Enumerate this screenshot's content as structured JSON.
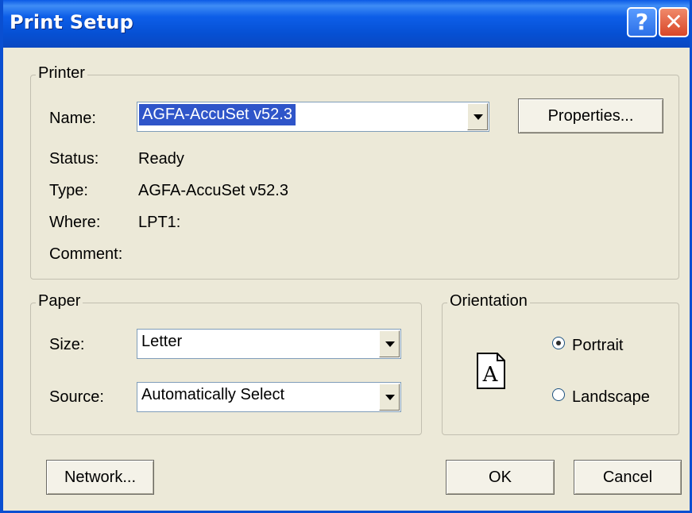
{
  "window": {
    "title": "Print Setup"
  },
  "titlebar": {
    "help_glyph": "?",
    "close_glyph": "✕"
  },
  "printer": {
    "group_label": "Printer",
    "name_label": "Name:",
    "name_value": "AGFA-AccuSet v52.3",
    "properties_button": "Properties...",
    "status_label": "Status:",
    "status_value": "Ready",
    "type_label": "Type:",
    "type_value": "AGFA-AccuSet v52.3",
    "where_label": "Where:",
    "where_value": "LPT1:",
    "comment_label": "Comment:",
    "comment_value": ""
  },
  "paper": {
    "group_label": "Paper",
    "size_label": "Size:",
    "size_value": "Letter",
    "source_label": "Source:",
    "source_value": "Automatically Select"
  },
  "orientation": {
    "group_label": "Orientation",
    "page_glyph": "A",
    "portrait_label": "Portrait",
    "landscape_label": "Landscape",
    "selected": "Portrait"
  },
  "buttons": {
    "network": "Network...",
    "ok": "OK",
    "cancel": "Cancel"
  },
  "colors": {
    "titlebar": "#0a4fd1",
    "dialog": "#ece9d8",
    "selection": "#2f55c9"
  }
}
